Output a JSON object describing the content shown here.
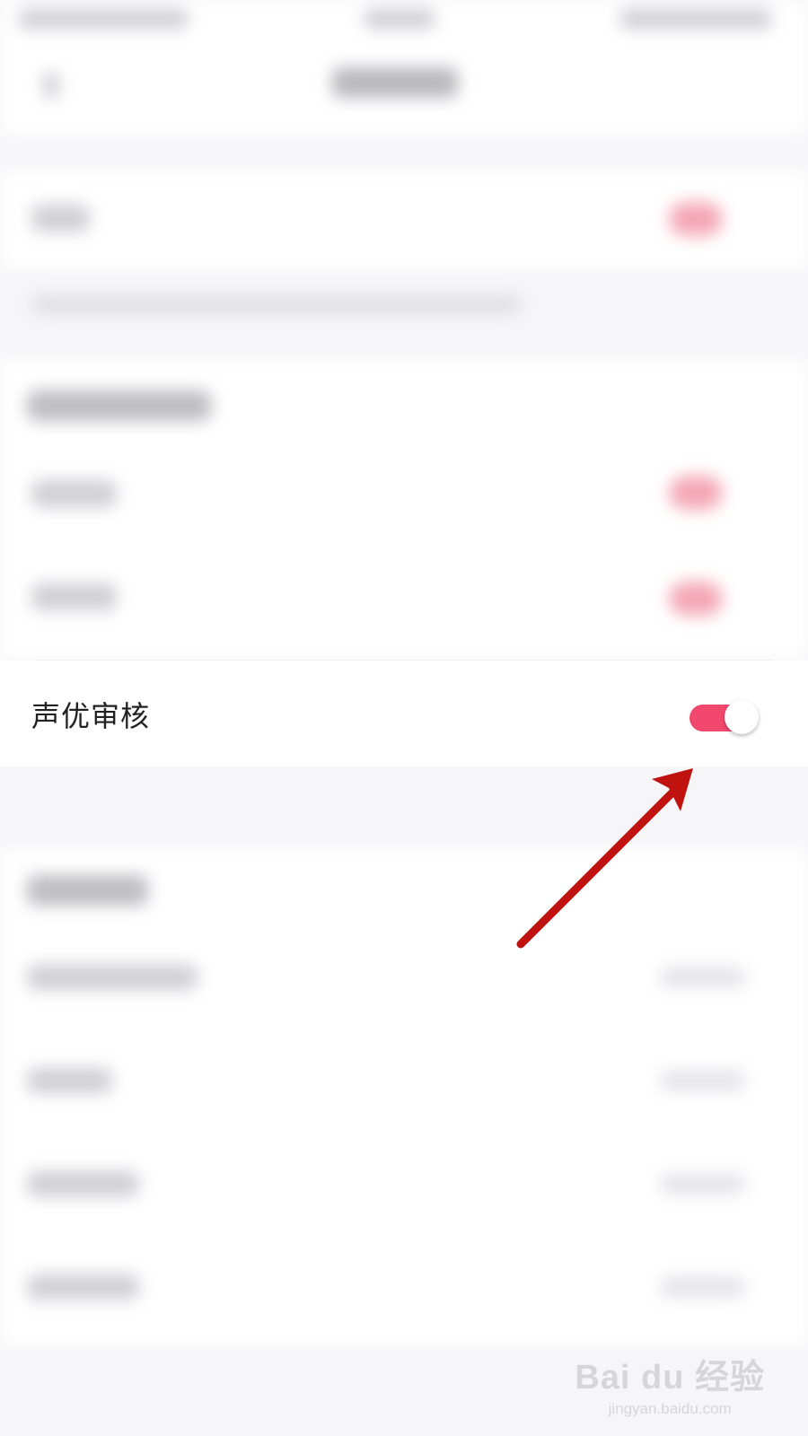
{
  "setting": {
    "label": "声优审核",
    "enabled": true,
    "accent_color": "#f2486e"
  },
  "arrow_color": "#c0130f",
  "watermark": {
    "logo": "Bai du 经验",
    "url": "jingyan.baidu.com"
  }
}
